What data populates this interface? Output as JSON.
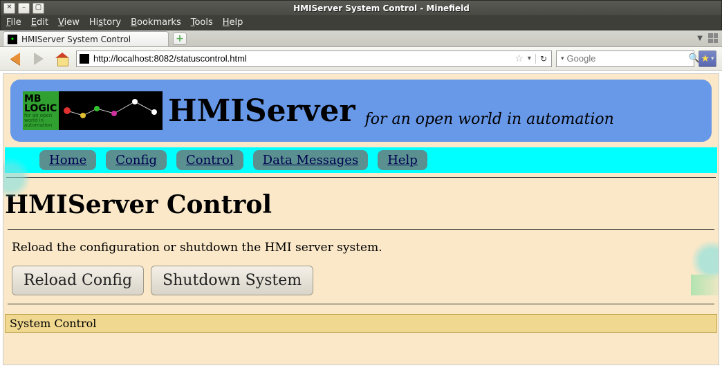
{
  "window": {
    "title": "HMIServer System Control - Minefield"
  },
  "menubar": {
    "file": "File",
    "edit": "Edit",
    "view": "View",
    "history": "History",
    "bookmarks": "Bookmarks",
    "tools": "Tools",
    "help": "Help"
  },
  "tab": {
    "title": "HMIServer System Control"
  },
  "urlbar": {
    "value": "http://localhost:8082/statuscontrol.html"
  },
  "searchbar": {
    "placeholder": "Google"
  },
  "page": {
    "brand_title": "HMIServer",
    "brand_tagline": "for an open world in automation",
    "logo_text1": "MB",
    "logo_text2": "LOGIC",
    "nav": {
      "home": "Home",
      "config": "Config",
      "control": "Control",
      "data_messages": "Data Messages",
      "help": "Help"
    },
    "heading": "HMIServer Control",
    "description": "Reload the configuration or shutdown the HMI server system.",
    "reload_btn": "Reload Config",
    "shutdown_btn": "Shutdown System",
    "footer": "System Control"
  }
}
